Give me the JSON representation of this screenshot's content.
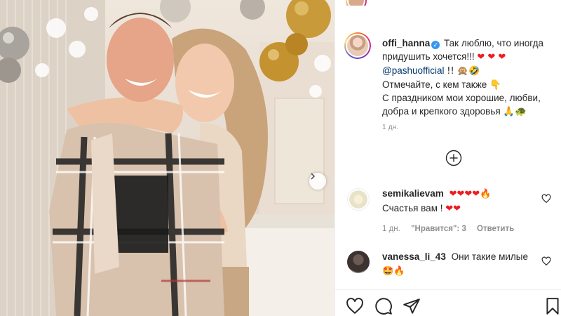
{
  "post": {
    "username": "offi_hanna",
    "caption_line1": "Так люблю, что иногда придушить хочется!!!",
    "caption_hearts": "❤ ❤ ❤",
    "mention": "@pashuofficial",
    "mention_suffix": "!! 🙊🤣",
    "caption_line3": "Отмечайте, с кем также 👇",
    "caption_line4": "С праздником мои хорошие, любви, добра и крепкого здоровья 🙏🐢",
    "time": "1 дн."
  },
  "comments": [
    {
      "username": "semikalievam",
      "hearts_line1": "❤❤❤❤🔥",
      "text": "Счастья вам !",
      "hearts_line2": "❤❤",
      "time": "1 дн.",
      "likes": "\"Нравится\": 3",
      "reply": "Ответить"
    },
    {
      "username": "vanessa_li_43",
      "text": "Они такие милые",
      "emoji_line": "🤩🔥"
    }
  ],
  "icons": {
    "verified": "verified-badge-icon",
    "load_more": "plus-circle-icon",
    "next": "chevron-right-icon",
    "like": "heart-outline-icon",
    "comment": "comment-bubble-icon",
    "share": "paper-plane-icon",
    "save": "bookmark-icon"
  },
  "colors": {
    "verified": "#3897f0",
    "mention": "#00376b",
    "heart": "#ed1c24",
    "muted": "#8e8e8e"
  }
}
